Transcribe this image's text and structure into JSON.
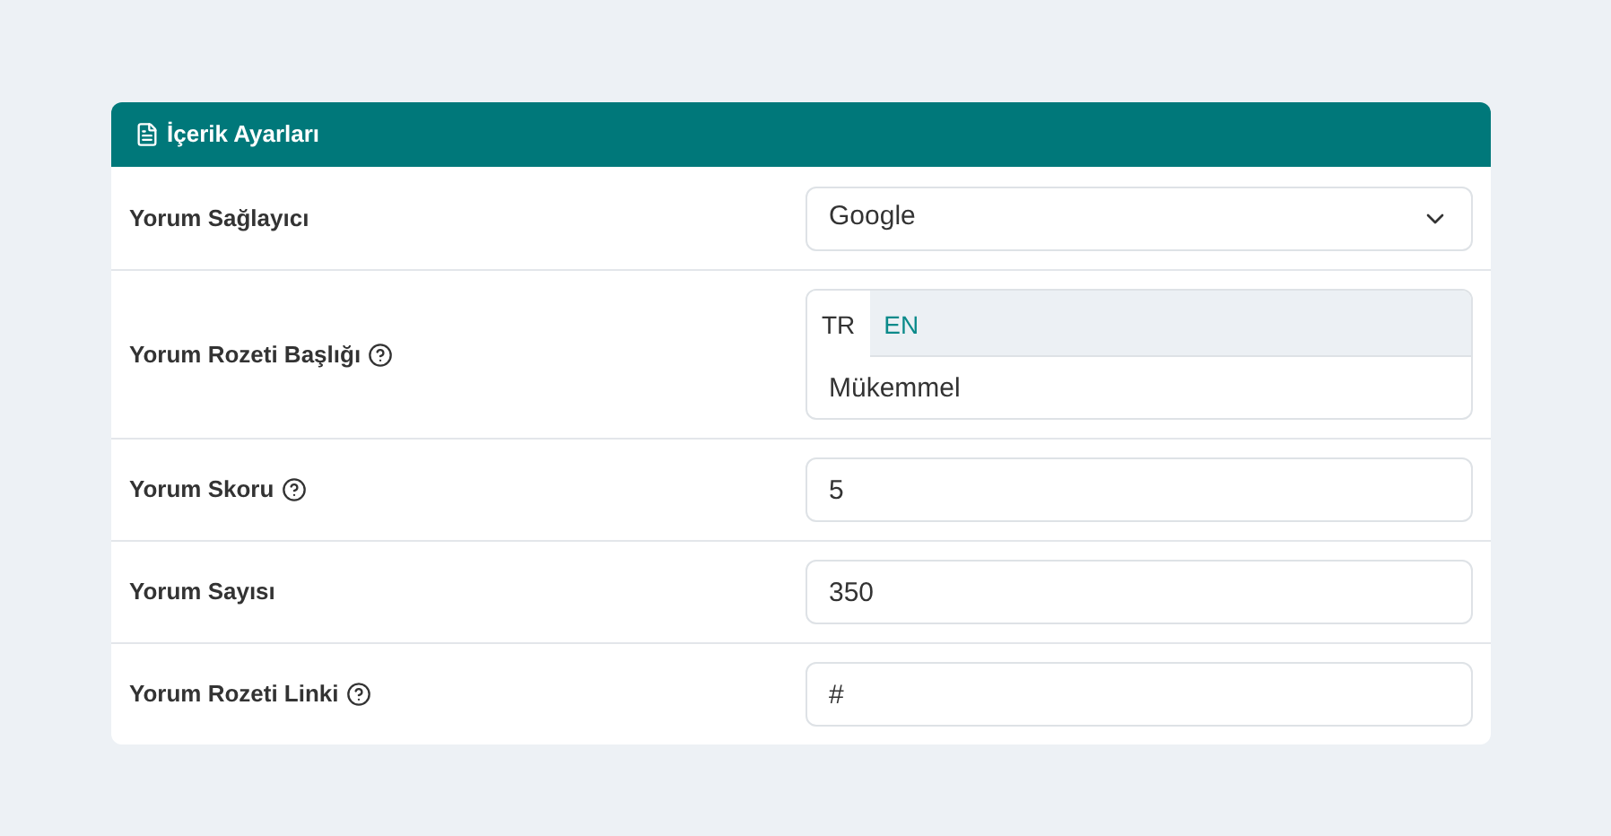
{
  "panel": {
    "title": "İçerik Ayarları"
  },
  "rows": [
    {
      "kind": "select",
      "label": "Yorum Sağlayıcı",
      "help": false,
      "value": "Google"
    },
    {
      "kind": "tabs",
      "label": "Yorum Rozeti Başlığı",
      "help": true,
      "tabs": [
        {
          "label": "TR",
          "selected": true
        },
        {
          "label": "EN",
          "selected": false
        }
      ],
      "value": "Mükemmel"
    },
    {
      "kind": "input",
      "label": "Yorum Skoru",
      "help": true,
      "value": "5"
    },
    {
      "kind": "input",
      "label": "Yorum Sayısı",
      "help": false,
      "value": "350"
    },
    {
      "kind": "input",
      "label": "Yorum Rozeti Linki",
      "help": true,
      "value": "#"
    }
  ]
}
